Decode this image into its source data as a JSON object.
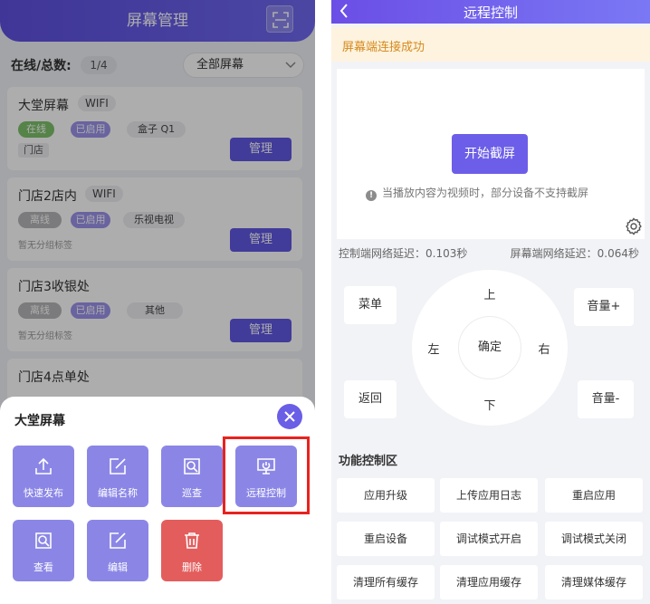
{
  "left": {
    "title": "屏幕管理",
    "count_label": "在线/总数:",
    "count_value": "1/4",
    "filter_value": "全部屏幕",
    "manage_label": "管理",
    "cards": [
      {
        "name": "大堂屏幕",
        "network": "WIFI",
        "status": "在线",
        "enabled": "已启用",
        "device": "盒子 Q1",
        "group": "门店"
      },
      {
        "name": "门店2店内",
        "network": "WIFI",
        "status": "离线",
        "enabled": "已启用",
        "device": "乐视电视",
        "group": "暂无分组标签"
      },
      {
        "name": "门店3收银处",
        "network": "",
        "status": "离线",
        "enabled": "已启用",
        "device": "其他",
        "group": "暂无分组标签"
      },
      {
        "name": "门店4点单处",
        "network": "",
        "status": "",
        "enabled": "",
        "device": "",
        "group": ""
      }
    ],
    "sheet": {
      "title": "大堂屏幕",
      "actions": [
        {
          "label": "快速发布",
          "icon": "upload-icon"
        },
        {
          "label": "编辑名称",
          "icon": "edit-icon"
        },
        {
          "label": "巡查",
          "icon": "search-icon"
        },
        {
          "label": "远程控制",
          "icon": "monitor-power-icon"
        },
        {
          "label": "查看",
          "icon": "search-icon"
        },
        {
          "label": "编辑",
          "icon": "edit-icon"
        },
        {
          "label": "删除",
          "icon": "trash-icon"
        }
      ]
    }
  },
  "right": {
    "title": "远程控制",
    "notice": "屏幕端连接成功",
    "start_button": "开始截屏",
    "info": "当播放内容为视频时，部分设备不支持截屏",
    "latency_control": "控制端网络延迟：0.103秒",
    "latency_screen": "屏幕端网络延迟：0.064秒",
    "remote": {
      "menu": "菜单",
      "back": "返回",
      "vol_up": "音量+",
      "vol_down": "音量-",
      "up": "上",
      "down": "下",
      "left": "左",
      "right": "右",
      "ok": "确定"
    },
    "section_title": "功能控制区",
    "functions": [
      "应用升级",
      "上传应用日志",
      "重启应用",
      "重启设备",
      "调试模式开启",
      "调试模式关闭",
      "清理所有缓存",
      "清理应用缓存",
      "清理媒体缓存"
    ]
  },
  "colors": {
    "primary": "#6158e4",
    "online": "#7ec26b",
    "offline": "#b5b5b8",
    "danger": "#e35d5d",
    "notice_text": "#d68a1d",
    "highlight": "#e8231f"
  }
}
